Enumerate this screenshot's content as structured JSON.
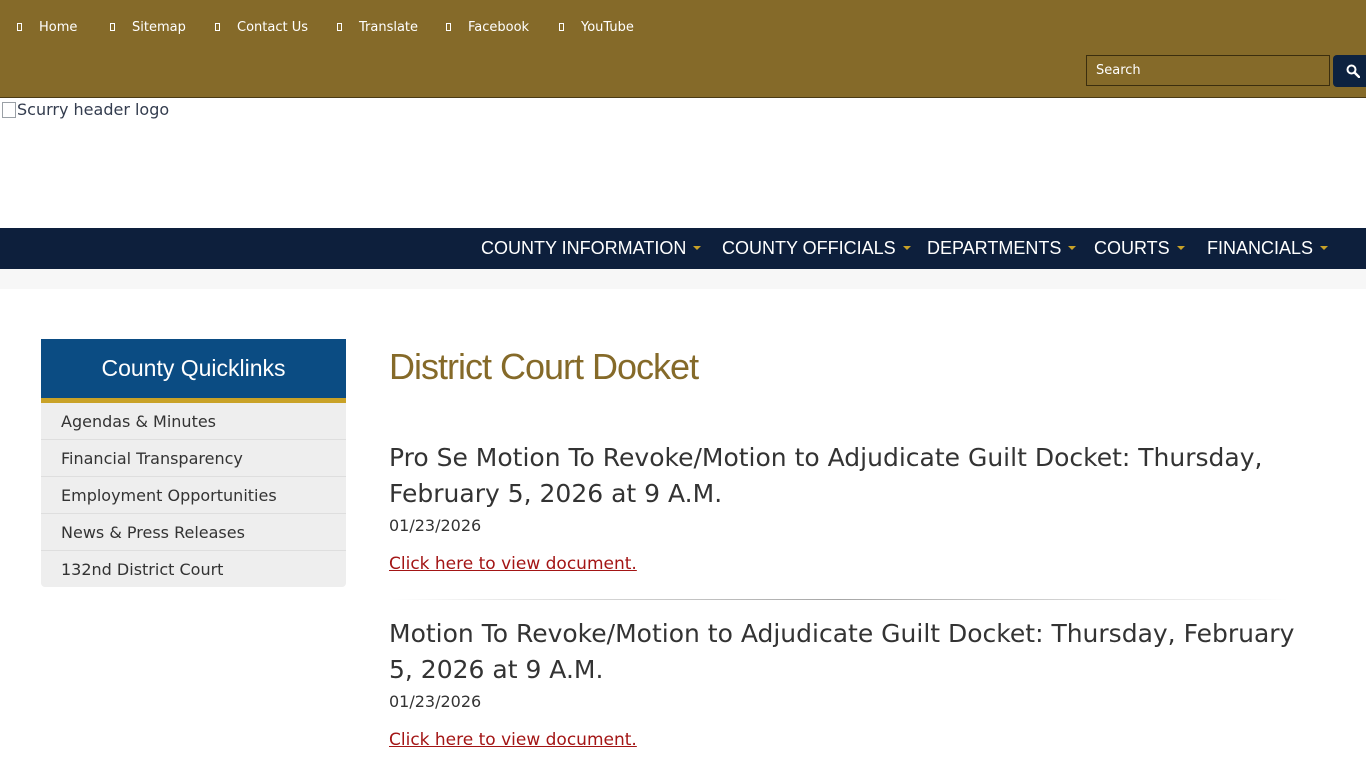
{
  "topbar": {
    "links": [
      {
        "label": "Home",
        "icon": "home-icon"
      },
      {
        "label": "Sitemap",
        "icon": "sitemap-icon"
      },
      {
        "label": "Contact Us",
        "icon": "contact-icon"
      },
      {
        "label": "Translate",
        "icon": "translate-icon"
      },
      {
        "label": "Facebook",
        "icon": "facebook-icon"
      },
      {
        "label": "YouTube",
        "icon": "youtube-icon"
      }
    ],
    "search_placeholder": "Search",
    "search_icon": "search-icon"
  },
  "header": {
    "logo_alt": "Scurry header logo"
  },
  "main_nav": {
    "items": [
      {
        "label": "COUNTY INFORMATION"
      },
      {
        "label": "COUNTY OFFICIALS"
      },
      {
        "label": "DEPARTMENTS"
      },
      {
        "label": "COURTS"
      },
      {
        "label": "FINANCIALS"
      }
    ]
  },
  "sidebar": {
    "title": "County Quicklinks",
    "items": [
      {
        "label": "Agendas & Minutes"
      },
      {
        "label": "Financial Transparency"
      },
      {
        "label": "Employment Opportunities"
      },
      {
        "label": "News & Press Releases"
      },
      {
        "label": "132nd District Court"
      }
    ]
  },
  "main": {
    "title": "District Court Docket",
    "entries": [
      {
        "title": "Pro Se Motion To Revoke/Motion to Adjudicate Guilt Docket: Thursday, February 5, 2026 at 9 A.M.",
        "date": "01/23/2026",
        "link": "Click here to view document."
      },
      {
        "title": "Motion To Revoke/Motion to Adjudicate Guilt Docket: Thursday, February 5, 2026 at 9 A.M.",
        "date": "01/23/2026",
        "link": "Click here to view document."
      }
    ]
  },
  "colors": {
    "topbar": "#856a29",
    "nav": "#0d1f3c",
    "sidebar_header": "#0b4c83",
    "accent_gold": "#c9a227",
    "link": "#a31515"
  }
}
